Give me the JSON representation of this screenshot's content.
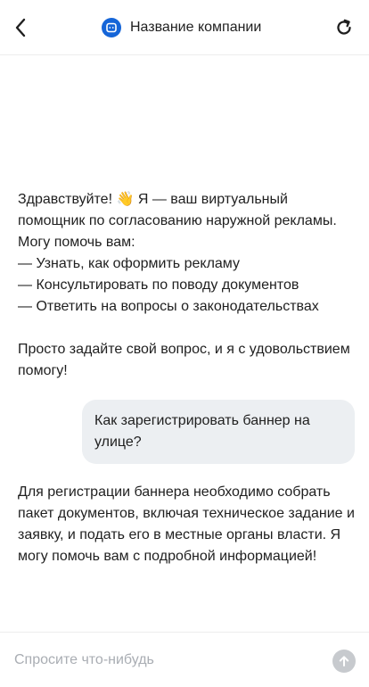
{
  "header": {
    "company_name": "Название компании",
    "back_icon": "chevron-left-icon",
    "logo_icon": "chat-bot-logo-icon",
    "refresh_icon": "refresh-icon",
    "brand_color": "#1565d8"
  },
  "messages": {
    "bot_greeting": "Здравствуйте! 👋 Я — ваш виртуальный помощник по согласованию наружной рекламы. Могу помочь вам:\n— Узнать, как оформить рекламу\n— Консультировать по поводу документов\n— Ответить на вопросы о законодательствах\n\nПросто задайте свой вопрос, и я с удовольствием помогу!",
    "user_question": "Как зарегистрировать баннер на улице?",
    "bot_answer": "Для регистрации баннера необходимо собрать пакет документов, включая техническое задание и заявку, и подать его в местные органы власти. Я могу помочь вам с подробной информацией!"
  },
  "input": {
    "placeholder": "Спросите что-нибудь",
    "value": "",
    "send_icon": "arrow-up-icon"
  }
}
